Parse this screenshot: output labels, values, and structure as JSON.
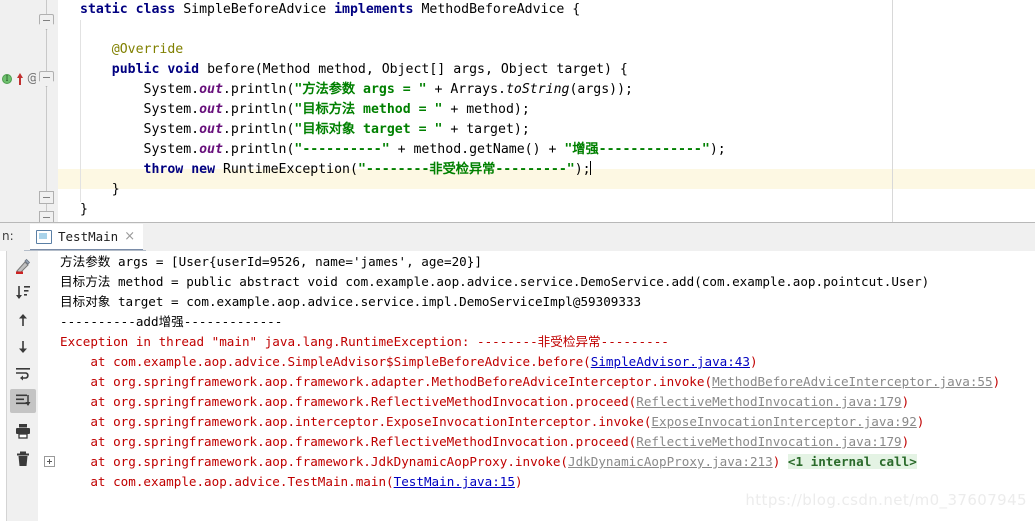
{
  "editor": {
    "margin_guide_x": 892,
    "gutter": {
      "implements_marker": "implements-marker",
      "override_marker": "@"
    },
    "lines": [
      {
        "indent": 0,
        "highlight": false,
        "tokens": [
          {
            "t": "kw",
            "v": "static"
          },
          {
            "t": "plain",
            "v": " "
          },
          {
            "t": "kw",
            "v": "class"
          },
          {
            "t": "plain",
            "v": " SimpleBeforeAdvice "
          },
          {
            "t": "kw",
            "v": "implements"
          },
          {
            "t": "plain",
            "v": " MethodBeforeAdvice {"
          }
        ]
      },
      {
        "indent": 0,
        "highlight": false,
        "tokens": []
      },
      {
        "indent": 0,
        "highlight": false,
        "tokens": [
          {
            "t": "ann",
            "v": "    @Override"
          }
        ]
      },
      {
        "indent": 0,
        "highlight": false,
        "tokens": [
          {
            "t": "plain",
            "v": "    "
          },
          {
            "t": "kw",
            "v": "public"
          },
          {
            "t": "plain",
            "v": " "
          },
          {
            "t": "kw",
            "v": "void"
          },
          {
            "t": "plain",
            "v": " before(Method method, Object[] args, Object target) {"
          }
        ]
      },
      {
        "indent": 0,
        "highlight": false,
        "tokens": [
          {
            "t": "plain",
            "v": "        System."
          },
          {
            "t": "fld",
            "v": "out"
          },
          {
            "t": "plain",
            "v": ".println("
          },
          {
            "t": "str",
            "v": "\"方法参数 args = \""
          },
          {
            "t": "plain",
            "v": " + Arrays."
          },
          {
            "t": "itl",
            "v": "toString"
          },
          {
            "t": "plain",
            "v": "(args));"
          }
        ]
      },
      {
        "indent": 0,
        "highlight": false,
        "tokens": [
          {
            "t": "plain",
            "v": "        System."
          },
          {
            "t": "fld",
            "v": "out"
          },
          {
            "t": "plain",
            "v": ".println("
          },
          {
            "t": "str",
            "v": "\"目标方法 method = \""
          },
          {
            "t": "plain",
            "v": " + method);"
          }
        ]
      },
      {
        "indent": 0,
        "highlight": false,
        "tokens": [
          {
            "t": "plain",
            "v": "        System."
          },
          {
            "t": "fld",
            "v": "out"
          },
          {
            "t": "plain",
            "v": ".println("
          },
          {
            "t": "str",
            "v": "\"目标对象 target = \""
          },
          {
            "t": "plain",
            "v": " + target);"
          }
        ]
      },
      {
        "indent": 0,
        "highlight": false,
        "tokens": [
          {
            "t": "plain",
            "v": "        System."
          },
          {
            "t": "fld",
            "v": "out"
          },
          {
            "t": "plain",
            "v": ".println("
          },
          {
            "t": "str",
            "v": "\"----------\""
          },
          {
            "t": "plain",
            "v": " + method.getName() + "
          },
          {
            "t": "str",
            "v": "\"增强-------------\""
          },
          {
            "t": "plain",
            "v": ");"
          }
        ]
      },
      {
        "indent": 0,
        "highlight": true,
        "caret": true,
        "tokens": [
          {
            "t": "plain",
            "v": "        "
          },
          {
            "t": "kw",
            "v": "throw"
          },
          {
            "t": "plain",
            "v": " "
          },
          {
            "t": "kw",
            "v": "new"
          },
          {
            "t": "plain",
            "v": " RuntimeException("
          },
          {
            "t": "str",
            "v": "\"--------非受检异常---------\""
          },
          {
            "t": "plain",
            "v": ");"
          }
        ]
      },
      {
        "indent": 0,
        "highlight": false,
        "tokens": [
          {
            "t": "plain",
            "v": "    }"
          }
        ]
      },
      {
        "indent": 0,
        "highlight": false,
        "tokens": [
          {
            "t": "plain",
            "v": "}"
          }
        ]
      }
    ]
  },
  "run_panel": {
    "tab_prefix": "n:",
    "tab": {
      "label": "TestMain",
      "icon": "run-configuration-icon",
      "close": "×"
    },
    "toolbar": [
      {
        "name": "rerun-failed-tests-icon"
      },
      {
        "name": "sort-alphabetically-icon"
      },
      {
        "name": "scroll-up-icon"
      },
      {
        "name": "scroll-down-icon"
      },
      {
        "name": "soft-wrap-icon"
      },
      {
        "name": "scroll-to-end-icon",
        "selected": true
      },
      {
        "name": "print-icon"
      },
      {
        "name": "clear-all-icon"
      }
    ],
    "console_lines": [
      {
        "color": "black",
        "segs": [
          {
            "t": "c-black",
            "v": "方法参数 args = [User{userId=9526, name='james', age=20}]"
          }
        ]
      },
      {
        "color": "black",
        "segs": [
          {
            "t": "c-black",
            "v": "目标方法 method = public abstract void com.example.aop.advice.service.DemoService.add(com.example.aop.pointcut.User)"
          }
        ]
      },
      {
        "color": "black",
        "segs": [
          {
            "t": "c-black",
            "v": "目标对象 target = com.example.aop.advice.service.impl.DemoServiceImpl@59309333"
          }
        ]
      },
      {
        "color": "black",
        "segs": [
          {
            "t": "c-black",
            "v": "----------add增强-------------"
          }
        ]
      },
      {
        "color": "red",
        "segs": [
          {
            "t": "c-red",
            "v": "Exception in thread \"main\" java.lang.RuntimeException: --------非受检异常---------"
          }
        ]
      },
      {
        "color": "red",
        "indent": true,
        "segs": [
          {
            "t": "c-red",
            "v": "    at com.example.aop.advice.SimpleAdvisor$SimpleBeforeAdvice.before("
          },
          {
            "t": "lnk",
            "v": "SimpleAdvisor.java:43"
          },
          {
            "t": "c-red",
            "v": ")"
          }
        ]
      },
      {
        "color": "red",
        "indent": true,
        "segs": [
          {
            "t": "c-red",
            "v": "    at org.springframework.aop.framework.adapter.MethodBeforeAdviceInterceptor.invoke("
          },
          {
            "t": "lnk-gray",
            "v": "MethodBeforeAdviceInterceptor.java:55"
          },
          {
            "t": "c-red",
            "v": ")"
          }
        ]
      },
      {
        "color": "red",
        "indent": true,
        "segs": [
          {
            "t": "c-red",
            "v": "    at org.springframework.aop.framework.ReflectiveMethodInvocation.proceed("
          },
          {
            "t": "lnk-gray",
            "v": "ReflectiveMethodInvocation.java:179"
          },
          {
            "t": "c-red",
            "v": ")"
          }
        ]
      },
      {
        "color": "red",
        "indent": true,
        "segs": [
          {
            "t": "c-red",
            "v": "    at org.springframework.aop.interceptor.ExposeInvocationInterceptor.invoke("
          },
          {
            "t": "lnk-gray",
            "v": "ExposeInvocationInterceptor.java:92"
          },
          {
            "t": "c-red",
            "v": ")"
          }
        ]
      },
      {
        "color": "red",
        "indent": true,
        "segs": [
          {
            "t": "c-red",
            "v": "    at org.springframework.aop.framework.ReflectiveMethodInvocation.proceed("
          },
          {
            "t": "lnk-gray",
            "v": "ReflectiveMethodInvocation.java:179"
          },
          {
            "t": "c-red",
            "v": ")"
          }
        ]
      },
      {
        "color": "red",
        "indent": true,
        "expander": true,
        "segs": [
          {
            "t": "c-red",
            "v": "    at org.springframework.aop.framework.JdkDynamicAopProxy.invoke("
          },
          {
            "t": "lnk-gray",
            "v": "JdkDynamicAopProxy.java:213"
          },
          {
            "t": "c-red",
            "v": ") "
          },
          {
            "t": "internal",
            "v": "<1 internal call>"
          }
        ]
      },
      {
        "color": "red",
        "indent": true,
        "segs": [
          {
            "t": "c-red",
            "v": "    at com.example.aop.advice.TestMain.main("
          },
          {
            "t": "lnk",
            "v": "TestMain.java:15"
          },
          {
            "t": "c-red",
            "v": ")"
          }
        ]
      }
    ]
  },
  "watermark": "https://blog.csdn.net/m0_37607945",
  "colors": {
    "keyword": "#000080",
    "string": "#008000",
    "annotation": "#808000",
    "field": "#660E7A",
    "error": "#c00000",
    "link": "#0000c0",
    "link_visited": "#8a8a8a",
    "highlight_row": "#fdf8e3",
    "panel_bg": "#f0f0f0",
    "tab_underline": "#7a8ca8",
    "internal_call_bg": "#e4f3e4"
  }
}
